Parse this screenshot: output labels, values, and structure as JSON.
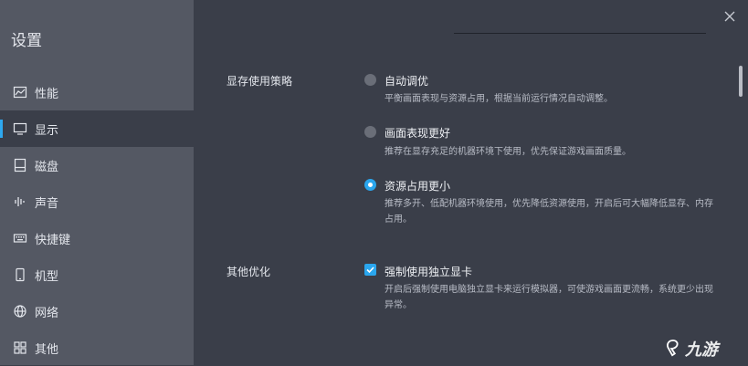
{
  "sidebar": {
    "title": "设置",
    "items": [
      {
        "label": "性能",
        "icon": "performance-chart-icon"
      },
      {
        "label": "显示",
        "icon": "monitor-icon"
      },
      {
        "label": "磁盘",
        "icon": "disk-icon"
      },
      {
        "label": "声音",
        "icon": "sound-wave-icon"
      },
      {
        "label": "快捷键",
        "icon": "keyboard-icon"
      },
      {
        "label": "机型",
        "icon": "phone-icon"
      },
      {
        "label": "网络",
        "icon": "globe-icon"
      },
      {
        "label": "其他",
        "icon": "grid-icon"
      }
    ],
    "active_index": 1
  },
  "sections": {
    "memory_strategy": {
      "label": "显存使用策略",
      "options": [
        {
          "label": "自动调优",
          "desc": "平衡画面表现与资源占用，根据当前运行情况自动调整。",
          "checked": false
        },
        {
          "label": "画面表现更好",
          "desc": "推荐在显存充足的机器环境下使用，优先保证游戏画面质量。",
          "checked": false
        },
        {
          "label": "资源占用更小",
          "desc": "推荐多开、低配机器环境使用，优先降低资源使用，开启后可大幅降低显存、内存占用。",
          "checked": true
        }
      ]
    },
    "other_opt": {
      "label": "其他优化",
      "option": {
        "label": "强制使用独立显卡",
        "desc": "开启后强制使用电脑独立显卡来运行模拟器，可使游戏画面更流畅，系统更少出现异常。",
        "checked": true
      }
    }
  },
  "watermark": {
    "text": "九游"
  },
  "colors": {
    "accent": "#2aa6ee",
    "sidebar_bg": "#545863",
    "main_bg": "#3a3e49"
  }
}
